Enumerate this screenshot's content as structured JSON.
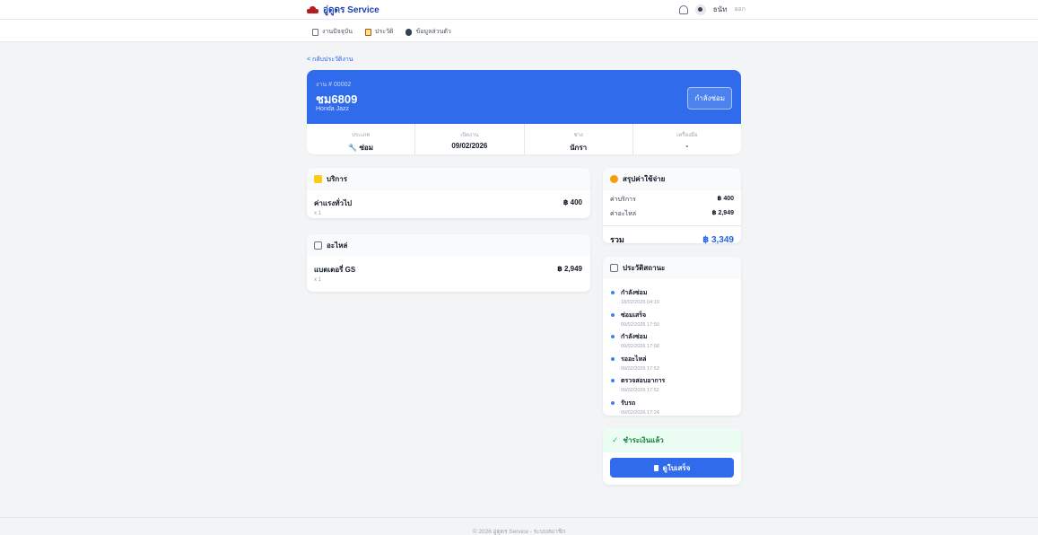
{
  "app": {
    "brand": "อู่ดูดร Service"
  },
  "user": {
    "name": "ธนัท",
    "role": "ออก"
  },
  "nav": {
    "items": [
      {
        "label": "งานปัจจุบัน"
      },
      {
        "label": "ประวัติ"
      },
      {
        "label": "ข้อมูลส่วนตัว"
      }
    ]
  },
  "back_link": "< กลับประวัติงาน",
  "job": {
    "number": "งาน # 00002",
    "plate": "ชม6809",
    "model": "Honda Jazz",
    "status": "กำลังซ่อม",
    "meta": [
      {
        "label": "ประเภท",
        "value": "ซ่อม"
      },
      {
        "label": "เปิดงาน",
        "value": "09/02/2026"
      },
      {
        "label": "ช่าง",
        "value": "นักรา"
      },
      {
        "label": "เครื่องมือ",
        "value": "-"
      }
    ]
  },
  "services": {
    "title": "บริการ",
    "items": [
      {
        "name": "ค่าแรงทั่วไป",
        "qty": "x 1",
        "price": "฿ 400"
      }
    ]
  },
  "parts": {
    "title": "อะไหล่",
    "items": [
      {
        "name": "แบตเตอรี่ GS",
        "qty": "x 1",
        "price": "฿ 2,949"
      }
    ]
  },
  "summary": {
    "title": "สรุปค่าใช้จ่าย",
    "rows": [
      {
        "label": "ค่าบริการ",
        "value": "฿ 400"
      },
      {
        "label": "ค่าอะไหล่",
        "value": "฿ 2,949"
      }
    ],
    "total_label": "รวม",
    "total_value": "฿ 3,349"
  },
  "history": {
    "title": "ประวัติสถานะ",
    "items": [
      {
        "status": "กำลังซ่อม",
        "time": "18/02/2026 04:19"
      },
      {
        "status": "ซ่อมเสร็จ",
        "time": "09/02/2026 17:59"
      },
      {
        "status": "กำลังซ่อม",
        "time": "09/02/2026 17:58"
      },
      {
        "status": "รออะไหล่",
        "time": "09/02/2026 17:53"
      },
      {
        "status": "ตรวจสอบอาการ",
        "time": "09/02/2026 17:52"
      },
      {
        "status": "รับรถ",
        "time": "09/02/2026 17:24"
      }
    ]
  },
  "payment": {
    "status": "ชำระเงินแล้ว",
    "button": "ดูใบเสร็จ"
  },
  "footer": "© 2026 อู่ดูดร Service - ระบบสมาชิก",
  "colors": {
    "primary": "#2f6bea",
    "success": "#15803d",
    "background": "#f3f4f6"
  }
}
